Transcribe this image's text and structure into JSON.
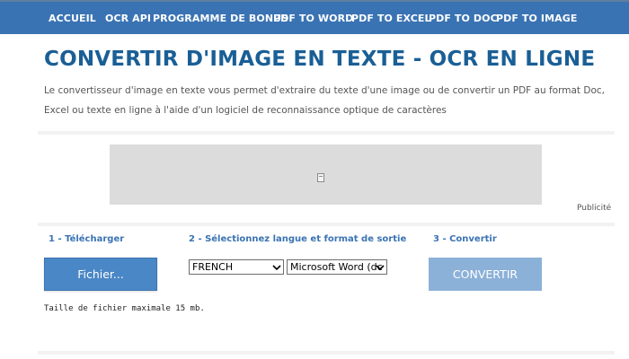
{
  "nav": {
    "items": [
      {
        "label": "ACCUEIL"
      },
      {
        "label": "OCR API"
      },
      {
        "label": "PROGRAMME DE BONUS"
      },
      {
        "label": "PDF TO WORD"
      },
      {
        "label": "PDF TO EXCEL"
      },
      {
        "label": "PDF TO DOC"
      },
      {
        "label": "PDF TO IMAGE"
      }
    ]
  },
  "main": {
    "title": "CONVERTIR D'IMAGE EN TEXTE - OCR EN LIGNE",
    "intro": "Le convertisseur d'image en texte vous permet d'extraire du texte d'une image ou de convertir un PDF au format Doc, Excel ou texte en ligne à l'aide d'un logiciel de reconnaissance optique de caractères"
  },
  "ad": {
    "label": "Publicité",
    "icon": "broken-image-icon"
  },
  "steps": {
    "upload_label": "1 - Télécharger",
    "select_label": "2 - Sélectionnez langue et format de sortie",
    "convert_label": "3 - Convertir"
  },
  "controls": {
    "file_button": "Fichier...",
    "language_value": "FRENCH",
    "format_value": "Microsoft Word (dc",
    "convert_button": "CONVERTIR"
  },
  "notes": {
    "max_size": "Taille de fichier maximale 15 mb."
  },
  "colors": {
    "nav_bg": "#3a73b3",
    "title": "#1a5f96",
    "button_primary": "#4a87c6",
    "button_disabled": "#8cb1d8"
  }
}
